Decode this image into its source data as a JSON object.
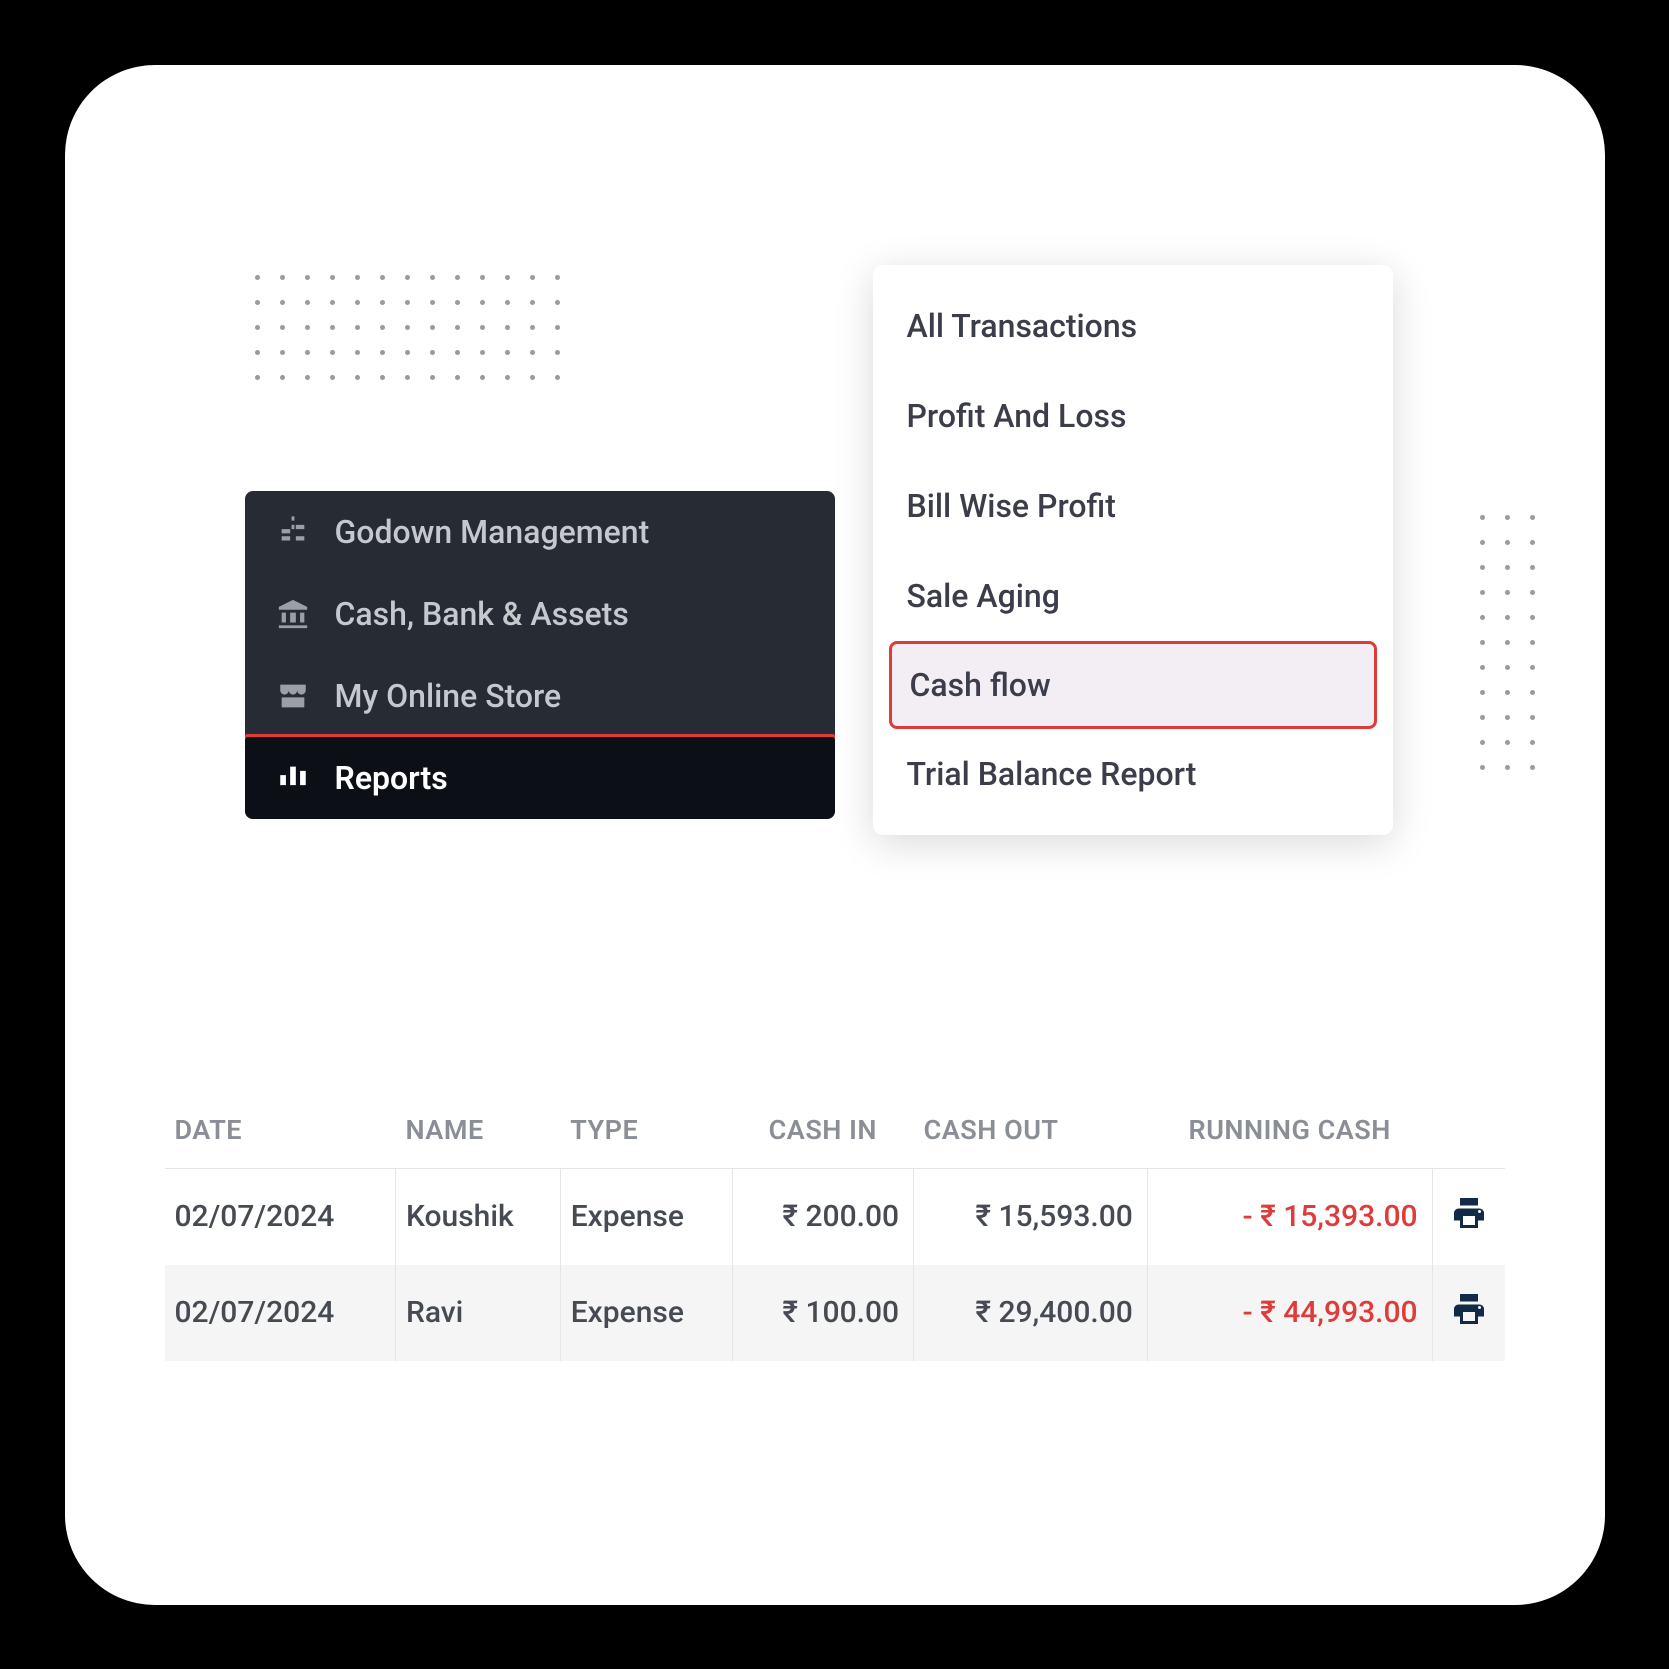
{
  "sidebar": {
    "items": [
      {
        "label": "Godown Management"
      },
      {
        "label": "Cash, Bank & Assets"
      },
      {
        "label": "My Online Store"
      },
      {
        "label": "Reports"
      }
    ]
  },
  "submenu": {
    "items": [
      {
        "label": "All Transactions"
      },
      {
        "label": "Profit And Loss"
      },
      {
        "label": "Bill Wise Profit"
      },
      {
        "label": "Sale Aging"
      },
      {
        "label": "Cash flow"
      },
      {
        "label": "Trial Balance Report"
      }
    ]
  },
  "table": {
    "headers": {
      "date": "DATE",
      "name": "NAME",
      "type": "TYPE",
      "cash_in": "CASH IN",
      "cash_out": "CASH OUT",
      "running": "RUNNING CASH"
    },
    "rows": [
      {
        "date": "02/07/2024",
        "name": "Koushik",
        "type": "Expense",
        "cash_in": "₹ 200.00",
        "cash_out": "₹ 15,593.00",
        "running": "- ₹ 15,393.00"
      },
      {
        "date": "02/07/2024",
        "name": "Ravi",
        "type": "Expense",
        "cash_in": "₹ 100.00",
        "cash_out": "₹ 29,400.00",
        "running": "- ₹ 44,993.00"
      }
    ]
  }
}
